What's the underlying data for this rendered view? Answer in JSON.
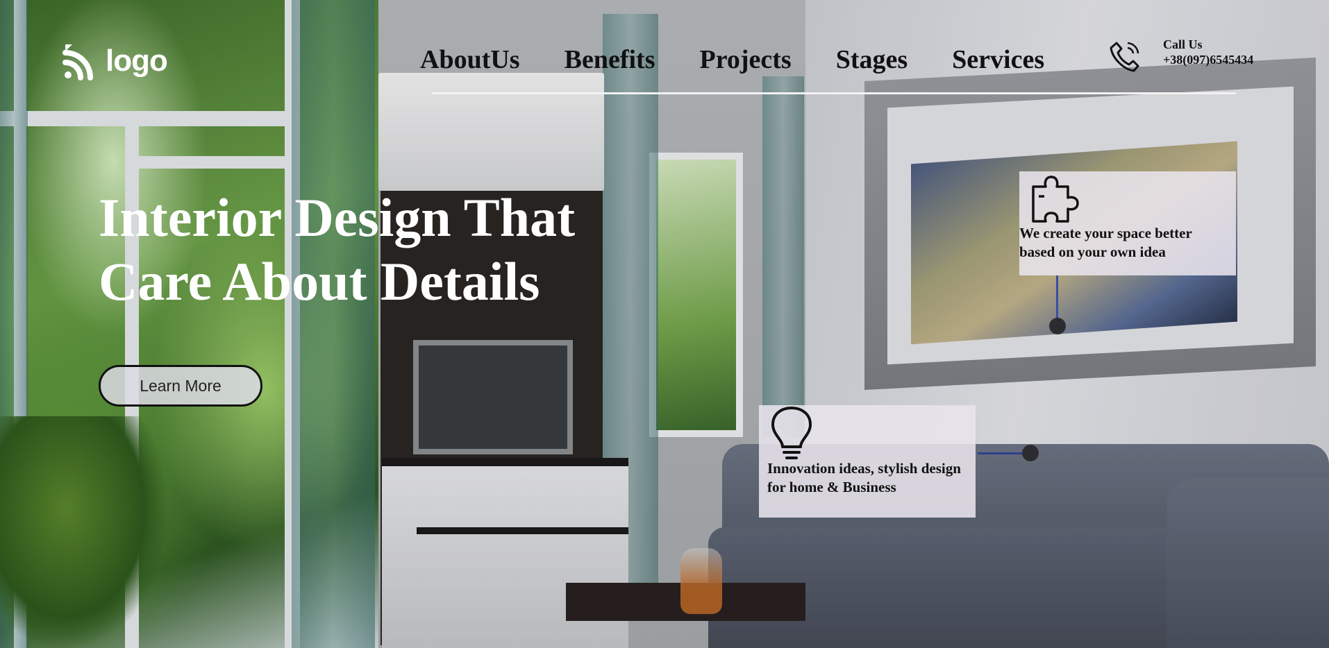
{
  "header": {
    "logo_text": "logo",
    "nav": [
      "AboutUs",
      "Benefits",
      "Projects",
      "Stages",
      "Services"
    ],
    "call_label": "Call Us",
    "phone": "+38(097)6545434"
  },
  "hero": {
    "title_line1": "Interior Design That",
    "title_line2": "Care About Details",
    "cta_label": "Learn More"
  },
  "features": [
    {
      "icon": "puzzle-icon",
      "text": "We create your space better based on your own idea"
    },
    {
      "icon": "lightbulb-icon",
      "text_line1": "Innovation ideas, stylish design",
      "text_line2": "for home & Business"
    }
  ]
}
